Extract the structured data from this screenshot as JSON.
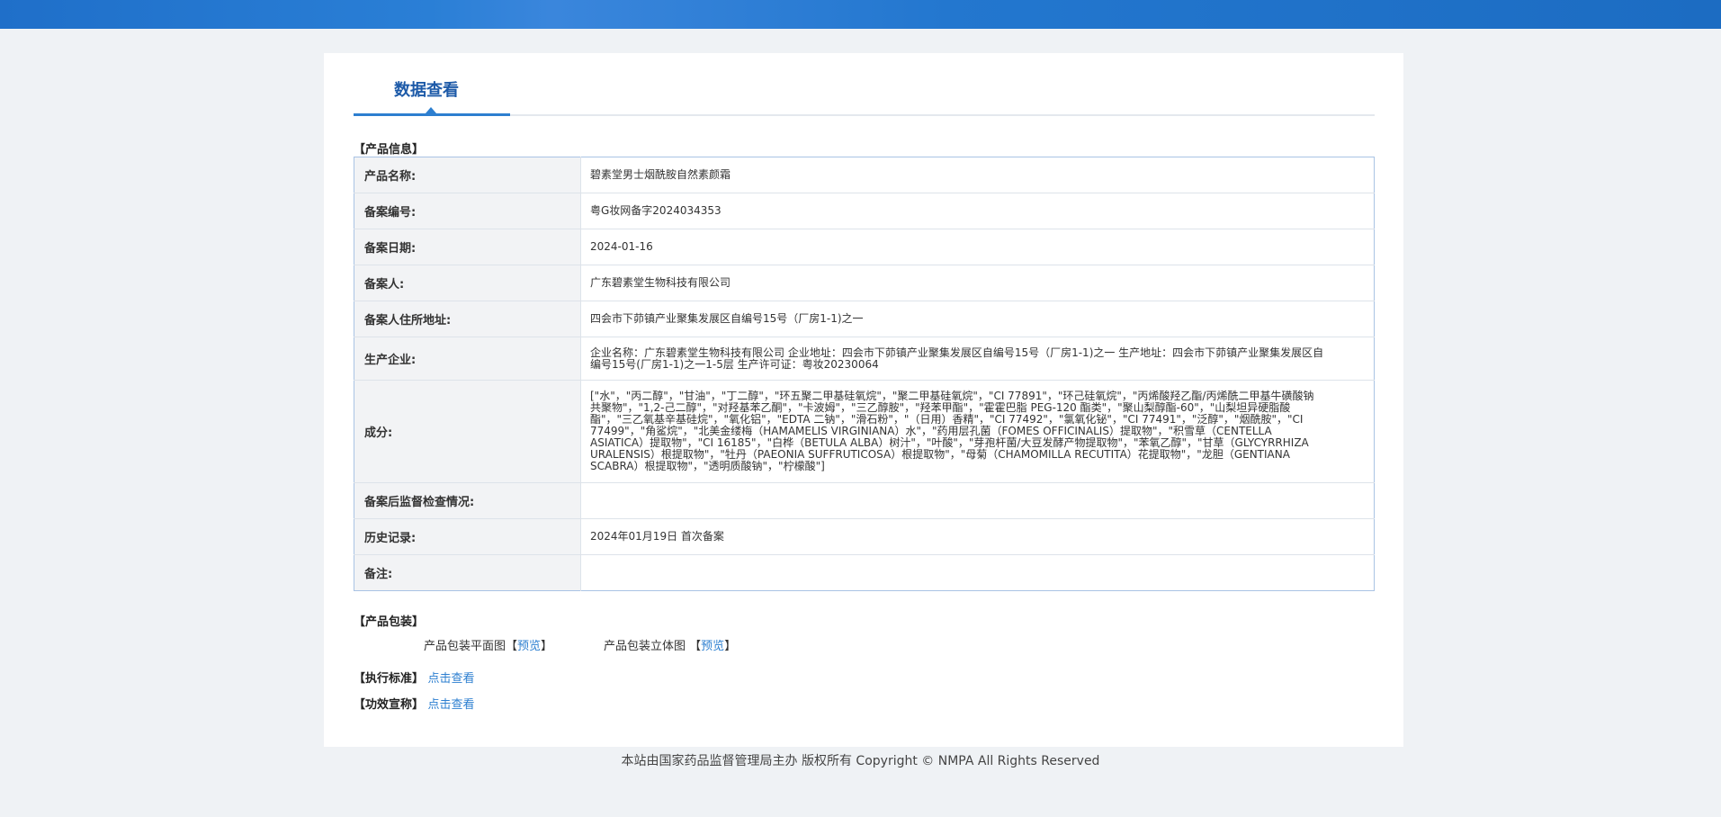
{
  "tab": {
    "title": "数据查看"
  },
  "product_info": {
    "section_title": "【产品信息】",
    "rows": [
      {
        "label": "产品名称:",
        "value": "碧素堂男士烟酰胺自然素颜霜"
      },
      {
        "label": "备案编号:",
        "value": "粤G妆网备字2024034353"
      },
      {
        "label": "备案日期:",
        "value": "2024-01-16"
      },
      {
        "label": "备案人:",
        "value": "广东碧素堂生物科技有限公司"
      },
      {
        "label": "备案人住所地址:",
        "value": "四会市下茆镇产业聚集发展区自编号15号（厂房1-1)之一"
      },
      {
        "label": "生产企业:",
        "value": "企业名称：广东碧素堂生物科技有限公司 企业地址：四会市下茆镇产业聚集发展区自编号15号（厂房1-1)之一 生产地址：四会市下茆镇产业聚集发展区自编号15号(厂房1-1)之一1-5层 生产许可证：粤妆20230064"
      },
      {
        "label": "成分:",
        "value": "[\"水\"，\"丙二醇\"，\"甘油\"，\"丁二醇\"，\"环五聚二甲基硅氧烷\"，\"聚二甲基硅氧烷\"，\"CI 77891\"，\"环己硅氧烷\"，\"丙烯酸羟乙酯/丙烯酰二甲基牛磺酸钠共聚物\"，\"1,2-己二醇\"，\"对羟基苯乙酮\"，\"卡波姆\"，\"三乙醇胺\"，\"羟苯甲酯\"，\"霍霍巴脂 PEG-120 酯类\"，\"聚山梨醇酯-60\"，\"山梨坦异硬脂酸酯\"，\"三乙氧基辛基硅烷\"，\"氧化铝\"，\"EDTA 二钠\"，\"滑石粉\"，\"（日用）香精\"，\"CI 77492\"，\"氯氧化铋\"，\"CI 77491\"，\"泛醇\"，\"烟酰胺\"，\"CI 77499\"，\"角鲨烷\"，\"北美金缕梅（HAMAMELIS VIRGINIANA）水\"，\"药用层孔菌（FOMES OFFICINALIS）提取物\"，\"积雪草（CENTELLA ASIATICA）提取物\"，\"CI 16185\"，\"白桦（BETULA ALBA）树汁\"，\"叶酸\"，\"芽孢杆菌/大豆发酵产物提取物\"，\"苯氧乙醇\"，\"甘草（GLYCYRRHIZA URALENSIS）根提取物\"，\"牡丹（PAEONIA SUFFRUTICOSA）根提取物\"，\"母菊（CHAMOMILLA RECUTITA）花提取物\"，\"龙胆（GENTIANA SCABRA）根提取物\"，\"透明质酸钠\"，\"柠檬酸\"]"
      },
      {
        "label": "备案后监督检查情况:",
        "value": ""
      },
      {
        "label": "历史记录:",
        "value": "2024年01月19日 首次备案"
      },
      {
        "label": "备注:",
        "value": ""
      }
    ]
  },
  "packaging": {
    "section_title": "【产品包装】",
    "flat_label": "产品包装平面图",
    "solid_label": "产品包装立体图",
    "bracket_open": "【",
    "bracket_close": "】",
    "preview_link": "预览"
  },
  "standard": {
    "section_title": "【执行标准】",
    "link": "点击查看"
  },
  "efficacy": {
    "section_title": "【功效宣称】",
    "link": "点击查看"
  },
  "footer": {
    "text": "本站由国家药品监督管理局主办 版权所有 Copyright © NMPA All Rights Reserved"
  }
}
